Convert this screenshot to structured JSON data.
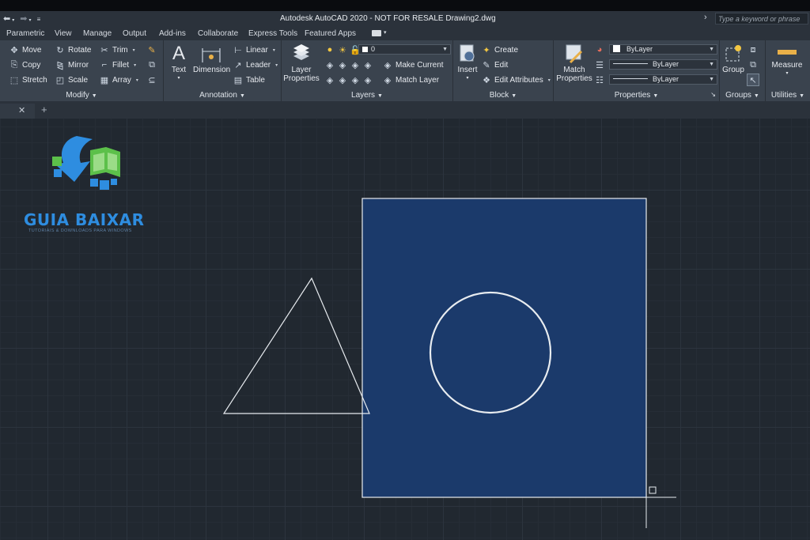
{
  "window": {
    "qat_icons": [
      "undo-icon",
      "redo-icon",
      "customize-icon"
    ],
    "title": "Autodesk AutoCAD 2020 - NOT FOR RESALE    Drawing2.dwg",
    "search_placeholder": "Type a keyword or phrase"
  },
  "tabs": [
    "Parametric",
    "View",
    "Manage",
    "Output",
    "Add-ins",
    "Collaborate",
    "Express Tools",
    "Featured Apps"
  ],
  "ribbon": {
    "modify": {
      "label": "Modify",
      "move": "Move",
      "copy": "Copy",
      "stretch": "Stretch",
      "rotate": "Rotate",
      "mirror": "Mirror",
      "scale": "Scale",
      "trim": "Trim",
      "fillet": "Fillet",
      "array": "Array"
    },
    "annotation": {
      "label": "Annotation",
      "text": "Text",
      "dimension": "Dimension",
      "linear": "Linear",
      "leader": "Leader",
      "table": "Table"
    },
    "layers": {
      "label": "Layers",
      "layer_properties": "Layer Properties",
      "current_layer": "0",
      "make_current": "Make Current",
      "match_layer": "Match Layer"
    },
    "block": {
      "label": "Block",
      "insert": "Insert",
      "create": "Create",
      "edit": "Edit",
      "edit_attributes": "Edit Attributes"
    },
    "properties": {
      "label": "Properties",
      "match_properties": "Match Properties",
      "color": "ByLayer",
      "linetype": "ByLayer",
      "lineweight": "ByLayer"
    },
    "groups": {
      "label": "Groups",
      "group": "Group"
    },
    "utilities": {
      "label": "Utilities",
      "measure": "Measure"
    }
  },
  "logo": {
    "name": "GUIA BAIXAR",
    "tagline": "TUTORIAIS & DOWNLOADS PARA WINDOWS"
  },
  "colors": {
    "canvas": "#212830",
    "ribbon": "#3a434e",
    "rect_fill": "#1b3a6b",
    "stroke": "#e8ecf0",
    "logo_blue": "#2e8de0",
    "logo_green": "#5cc04a"
  }
}
